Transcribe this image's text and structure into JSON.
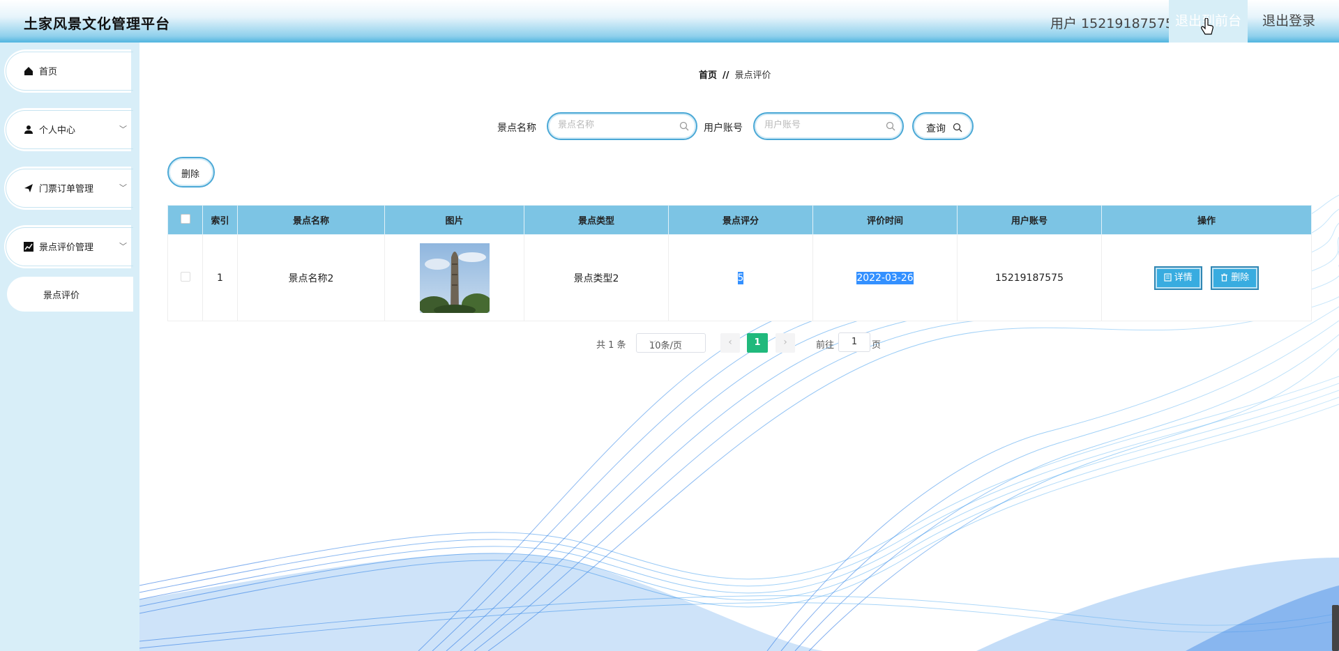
{
  "header": {
    "app_title": "土家风景文化管理平台",
    "user_label": "用户 15219187575",
    "back_front": "退出到前台",
    "logout": "退出登录"
  },
  "sidebar": {
    "items": [
      {
        "label": "首页",
        "icon": "home-icon"
      },
      {
        "label": "个人中心",
        "icon": "user-icon"
      },
      {
        "label": "门票订单管理",
        "icon": "paper-plane-icon"
      },
      {
        "label": "景点评价管理",
        "icon": "chart-icon"
      }
    ],
    "sub_item": "景点评价"
  },
  "breadcrumb": {
    "home": "首页",
    "sep": "//",
    "current": "景点评价"
  },
  "search": {
    "name_label": "景点名称",
    "name_placeholder": "景点名称",
    "account_label": "用户账号",
    "account_placeholder": "用户账号",
    "query_label": "查询"
  },
  "actions": {
    "delete_label": "删除"
  },
  "table": {
    "headers": [
      "索引",
      "景点名称",
      "图片",
      "景点类型",
      "景点评分",
      "评价时间",
      "用户账号",
      "操作"
    ],
    "rows": [
      {
        "index": "1",
        "name": "景点名称2",
        "type": "景点类型2",
        "score": "5",
        "time": "2022-03-26",
        "account": "15219187575",
        "detail": "详情",
        "delete": "删除"
      }
    ]
  },
  "pagination": {
    "total": "共 1 条",
    "page_size": "10条/页",
    "current_page": "1",
    "goto_label": "前往",
    "goto_value": "1",
    "page_unit": "页"
  },
  "colors": {
    "accent": "#38ace0",
    "header_blue": "#7cc4e4",
    "page_active": "#20b97c"
  }
}
